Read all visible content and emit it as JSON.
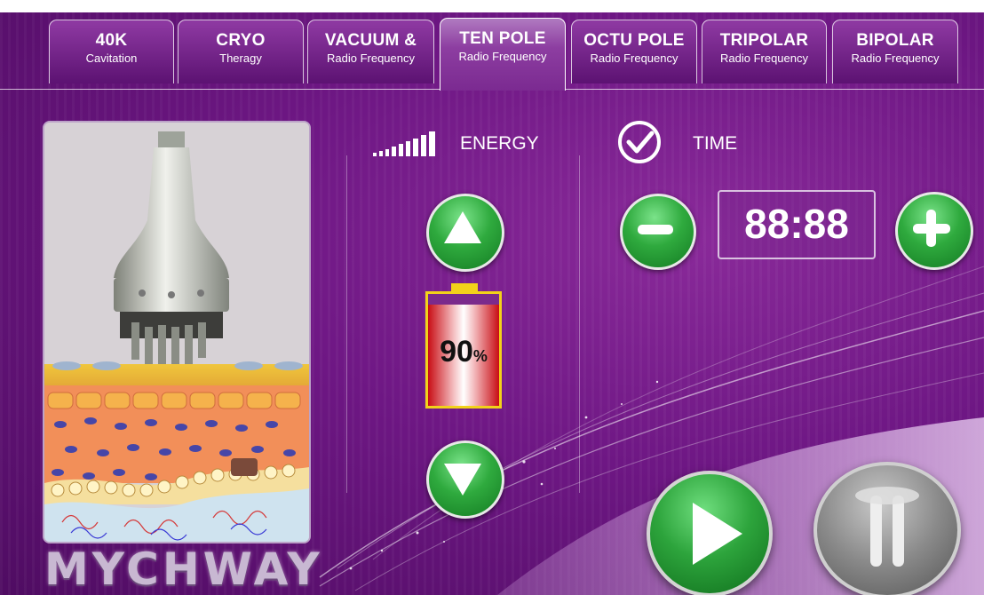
{
  "tabs": [
    {
      "title": "40K",
      "subtitle": "Cavitation"
    },
    {
      "title": "CRYO",
      "subtitle": "Theragy"
    },
    {
      "title": "VACUUM &",
      "subtitle": "Radio Frequency"
    },
    {
      "title": "TEN POLE",
      "subtitle": "Radio Frequency",
      "active": true
    },
    {
      "title": "OCTU POLE",
      "subtitle": "Radio Frequency"
    },
    {
      "title": "TRIPOLAR",
      "subtitle": "Radio Frequency"
    },
    {
      "title": "BIPOLAR",
      "subtitle": "Radio Frequency"
    }
  ],
  "energy": {
    "label": "ENERGY",
    "level_percent": "90",
    "percent_sign": "%"
  },
  "time": {
    "label": "TIME",
    "display": "88:88"
  },
  "brand": {
    "name": "MYCHWAY"
  },
  "icons": {
    "energy": "signal-bars-icon",
    "time": "check-circle-icon",
    "up": "triangle-up-icon",
    "down": "triangle-down-icon",
    "minus": "minus-icon",
    "plus": "plus-icon",
    "start": "play-icon",
    "pause": "pause-icon"
  },
  "colors": {
    "background": "#6e1784",
    "button_green": "#2faa3e",
    "battery_border": "#f2d21a",
    "battery_fill": "#c80d14"
  }
}
